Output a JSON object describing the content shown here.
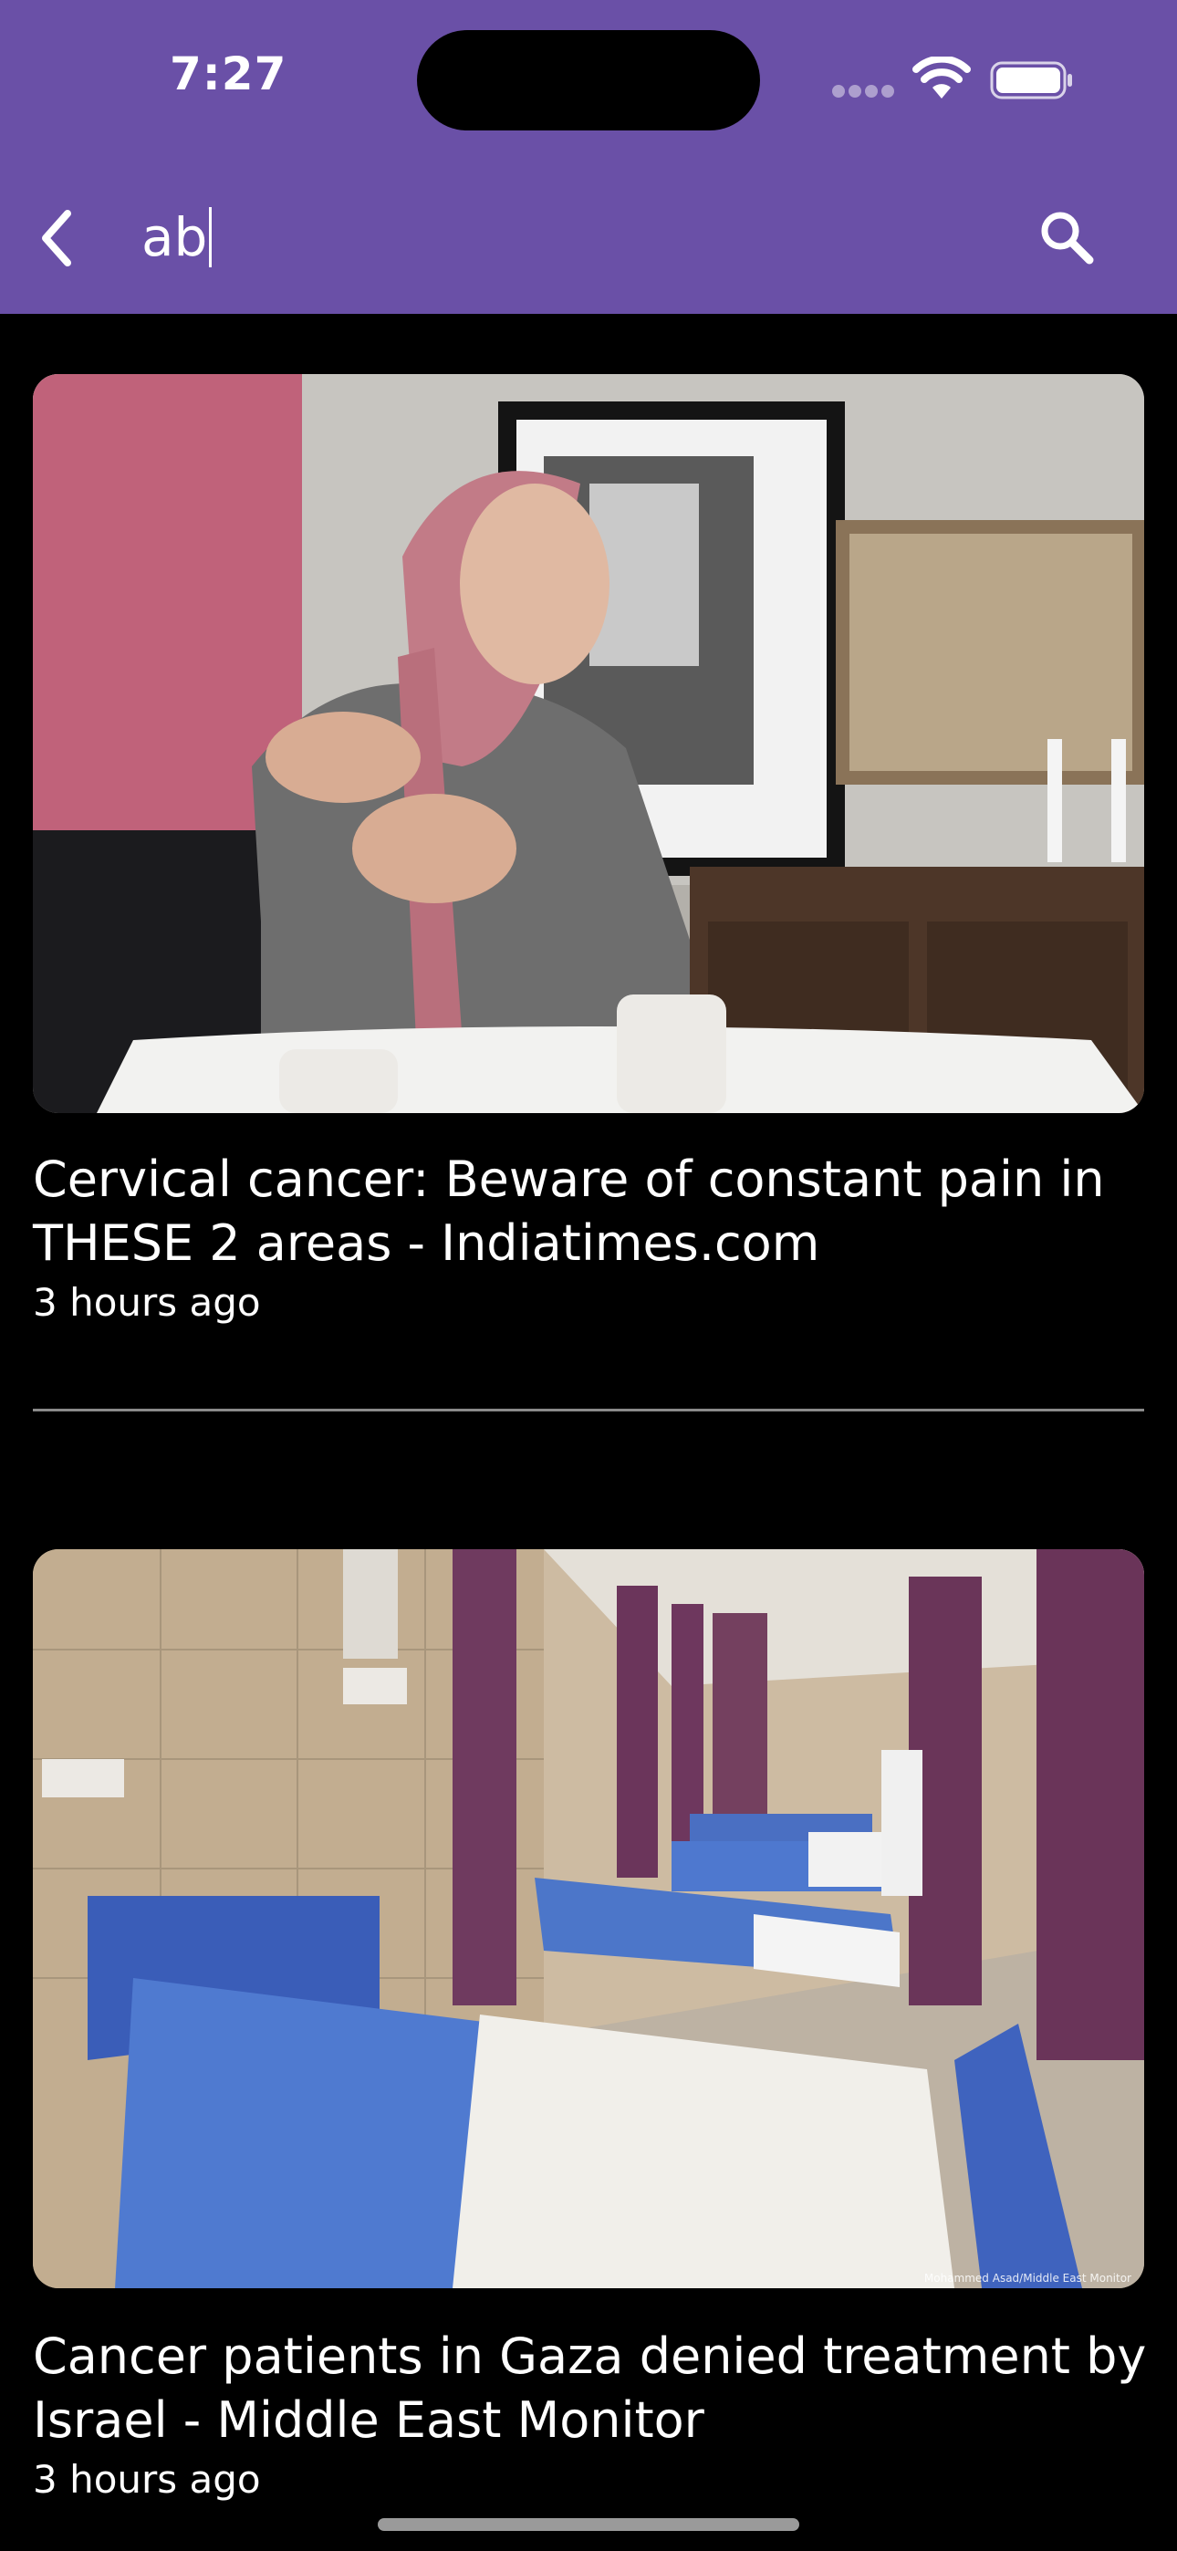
{
  "status_bar": {
    "time": "7:27"
  },
  "search_bar": {
    "query": "ab",
    "back_icon": "chevron-left-icon",
    "search_icon": "magnifier-icon"
  },
  "articles": [
    {
      "title": "Cervical cancer: Beware of constant pain in THESE 2 areas - Indiatimes.com",
      "time": "3 hours ago"
    },
    {
      "title": "Cancer patients in Gaza denied treatment by Israel - Middle East Monitor",
      "time": "3 hours ago",
      "photo_credit": "Mohammed Asad/Middle East Monitor"
    }
  ],
  "colors": {
    "app_bar": "#6a50a7",
    "background": "#000000",
    "text": "#ffffff",
    "divider": "#8a8a8a"
  }
}
